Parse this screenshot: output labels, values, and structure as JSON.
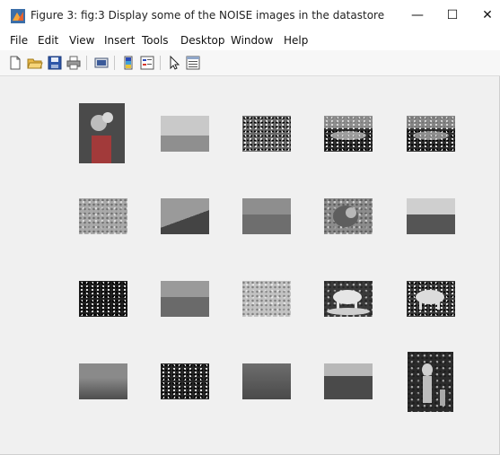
{
  "window": {
    "title": "Figure 3: fig:3 Display some of the NOISE images in the datastore",
    "minimize_glyph": "—",
    "maximize_glyph": "☐",
    "close_glyph": "✕"
  },
  "menu": {
    "items": [
      "File",
      "Edit",
      "View",
      "Insert",
      "Tools",
      "Desktop",
      "Window",
      "Help"
    ]
  },
  "toolbar": {
    "icons": [
      "new-figure-icon",
      "open-file-icon",
      "save-icon",
      "print-icon",
      "link-plot-icon",
      "colorbar-icon",
      "legend-icon",
      "pointer-icon",
      "property-editor-icon"
    ]
  },
  "thumbnails": {
    "rows": [
      [
        "portrait-with-dog",
        "gray-building",
        "dark-hills-noise",
        "dark-landscape-noise",
        "dark-landscape-noise-2"
      ],
      [
        "gray-noise-flat",
        "gray-slope",
        "gray-water-horizon",
        "gray-lion",
        "gray-salt-pepper"
      ],
      [
        "dark-night-noise",
        "gray-salt-pepper-2",
        "light-gray-noise",
        "cow-with-noise",
        "cow-salt-pepper"
      ],
      [
        "gray-sky-gradient",
        "dark-night-sky",
        "gray-rocks",
        "lake-reflection",
        "statues-dark"
      ]
    ]
  }
}
